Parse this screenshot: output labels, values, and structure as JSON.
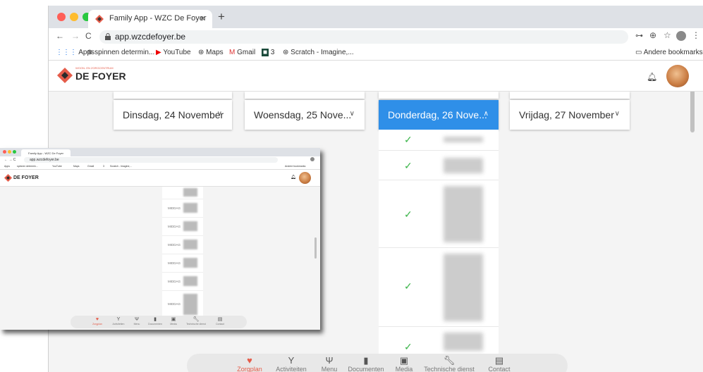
{
  "browser": {
    "tab_title": "Family App - WZC De Foyer",
    "tab_close": "×",
    "new_tab": "+",
    "url": "app.wzcdefoyer.be",
    "nav_back": "←",
    "nav_forward": "→",
    "nav_reload": "C",
    "bookmarks": [
      "Apps",
      "spinnen determin...",
      "YouTube",
      "Maps",
      "Gmail",
      "3",
      "Scratch - Imagine,..."
    ],
    "other_bookmarks": "Andere bookmarks",
    "traffic_colors": [
      "#ff5f57",
      "#febc2e",
      "#28c840"
    ]
  },
  "app": {
    "logo_small": "WOON- EN ZORGCENTRUM",
    "logo_main": "DE FOYER",
    "accent": "#2f8fe8",
    "brand": "#e55c4a"
  },
  "days": [
    {
      "label": "Dinsdag, 24 November",
      "active": false
    },
    {
      "label": "Woensdag, 25 Nove...",
      "active": false
    },
    {
      "label": "Donderdag, 26 Nove...",
      "active": true
    },
    {
      "label": "Vrijdag, 27 November",
      "active": false
    }
  ],
  "nav": [
    {
      "label": "Zorgplan",
      "icon": "heartbeat-icon",
      "active": true
    },
    {
      "label": "Activiteiten",
      "icon": "fitness-icon",
      "active": false
    },
    {
      "label": "Menu",
      "icon": "cutlery-icon",
      "active": false
    },
    {
      "label": "Documenten",
      "icon": "document-icon",
      "active": false
    },
    {
      "label": "Media",
      "icon": "image-icon",
      "active": false
    },
    {
      "label": "Technische dienst",
      "icon": "wrench-icon",
      "active": false
    },
    {
      "label": "Contact",
      "icon": "card-icon",
      "active": false
    }
  ],
  "mini": {
    "rows": [
      "MIDDAG",
      "MIDDAG",
      "MIDDAG",
      "MIDDAG",
      "MIDDAG",
      "MIDDAG"
    ]
  }
}
